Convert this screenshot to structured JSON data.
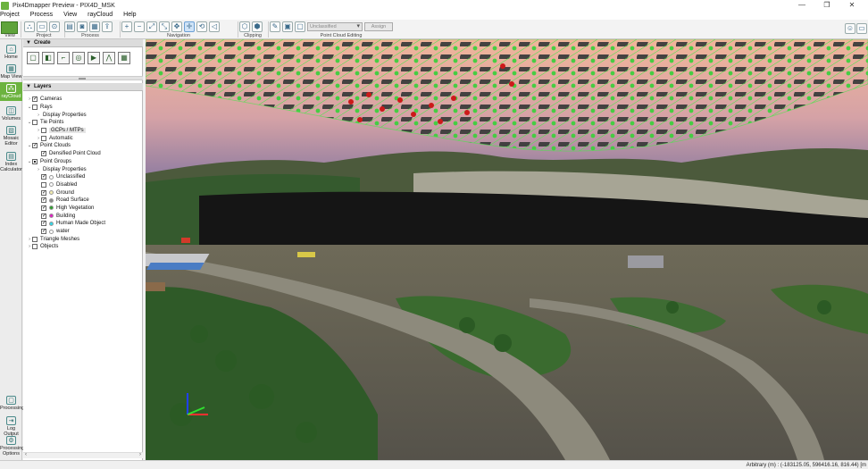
{
  "window": {
    "title": "Pix4Dmapper Preview - PIX4D_MSK",
    "controls": [
      "—",
      "❐",
      "✕"
    ]
  },
  "menu": [
    "Project",
    "Process",
    "View",
    "rayCloud",
    "Help"
  ],
  "toolbar": {
    "groups": [
      "View",
      "Project",
      "Process",
      "Navigation",
      "Clipping",
      "Point Cloud Editing"
    ],
    "class_select": "Unclassified",
    "assign_label": "Assign"
  },
  "modes": [
    {
      "label": "Home",
      "icon": "home-icon"
    },
    {
      "label": "Map View",
      "icon": "map-icon"
    },
    {
      "label": "rayCloud",
      "icon": "cloud-icon",
      "active": true
    },
    {
      "label": "Volumes",
      "icon": "volume-icon"
    },
    {
      "label": "Mosaic Editor",
      "icon": "mosaic-icon"
    },
    {
      "label": "Index Calculator",
      "icon": "index-icon"
    },
    {
      "label": "Processing",
      "icon": "processing-icon"
    },
    {
      "label": "Log Output",
      "icon": "log-icon"
    },
    {
      "label": "Processing Options",
      "icon": "gear-icon"
    }
  ],
  "panel": {
    "create_title": "Create",
    "layers_title": "Layers",
    "layers": [
      {
        "label": "Cameras",
        "indent": 0,
        "expander": "›",
        "check": "on"
      },
      {
        "label": "Rays",
        "indent": 0,
        "expander": "⌄",
        "check": "off"
      },
      {
        "label": "Display Properties",
        "indent": 1,
        "expander": "›",
        "check": "none"
      },
      {
        "label": "Tie Points",
        "indent": 0,
        "expander": "⌄",
        "check": "off"
      },
      {
        "label": "GCPs / MTPs",
        "indent": 1,
        "expander": "›",
        "check": "off",
        "highlight": true
      },
      {
        "label": "Automatic",
        "indent": 1,
        "expander": "›",
        "check": "off"
      },
      {
        "label": "Point Clouds",
        "indent": 0,
        "expander": "⌄",
        "check": "on"
      },
      {
        "label": "Densified Point Cloud",
        "indent": 1,
        "expander": "",
        "check": "on"
      },
      {
        "label": "Point Groups",
        "indent": 0,
        "expander": "⌄",
        "check": "part"
      },
      {
        "label": "Display Properties",
        "indent": 1,
        "expander": "›",
        "check": "none"
      },
      {
        "label": "Unclassified",
        "indent": 1,
        "expander": "",
        "check": "on",
        "color": "#ffffff"
      },
      {
        "label": "Disabled",
        "indent": 1,
        "expander": "",
        "check": "off",
        "color": "#ffffff"
      },
      {
        "label": "Ground",
        "indent": 1,
        "expander": "",
        "check": "on",
        "color": "#f2ecb0"
      },
      {
        "label": "Road Surface",
        "indent": 1,
        "expander": "",
        "check": "on",
        "color": "#8a8a8a"
      },
      {
        "label": "High Vegetation",
        "indent": 1,
        "expander": "",
        "check": "on",
        "color": "#2e9e2e"
      },
      {
        "label": "Building",
        "indent": 1,
        "expander": "",
        "check": "on",
        "color": "#e020c0"
      },
      {
        "label": "Human Made Object",
        "indent": 1,
        "expander": "",
        "check": "on",
        "color": "#33d6e6"
      },
      {
        "label": "water",
        "indent": 1,
        "expander": "",
        "check": "on",
        "color": "#ffffff"
      },
      {
        "label": "Triangle Meshes",
        "indent": 0,
        "expander": "›",
        "check": "off"
      },
      {
        "label": "Objects",
        "indent": 0,
        "expander": "›",
        "check": "off"
      }
    ]
  },
  "status": {
    "coords": "Arbitrary (m) : (-183125.05, 596416.16, 816.44) [m"
  }
}
